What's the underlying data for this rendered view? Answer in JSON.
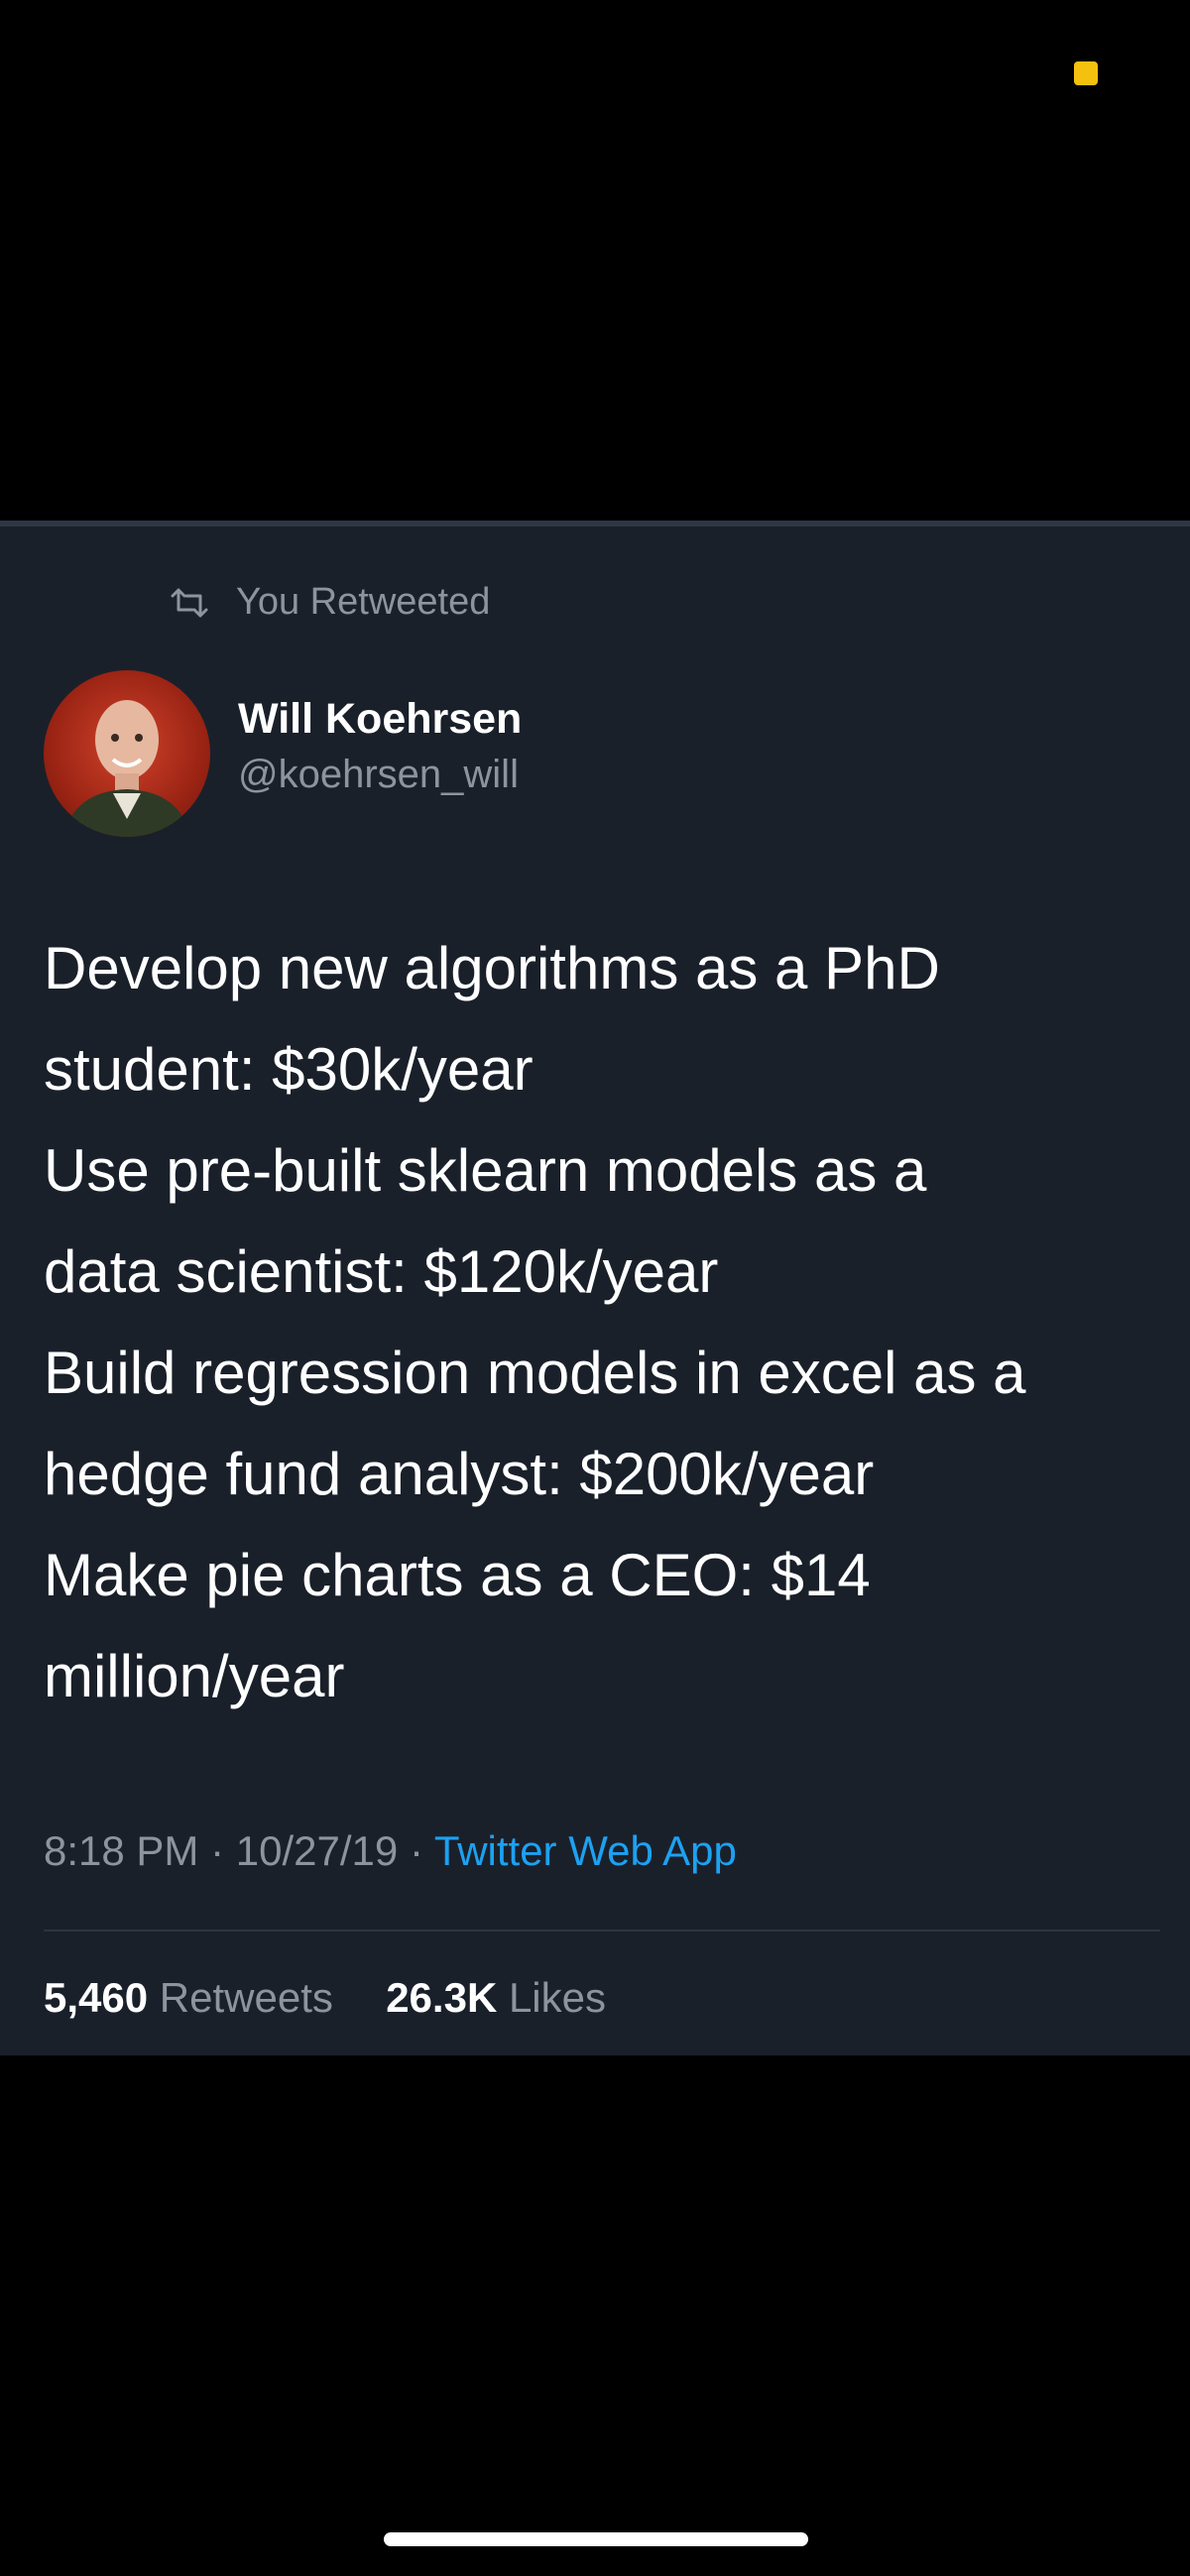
{
  "status_bar": {
    "indicator_color": "#f5c10f"
  },
  "tweet": {
    "retweet_label": "You Retweeted",
    "retweet_icon": "retweet-icon",
    "author": {
      "name": "Will Koehrsen",
      "handle": "@koehrsen_will",
      "avatar_icon": "avatar-photo"
    },
    "text_lines": [
      "Develop new algorithms as a PhD",
      "student: $30k/year",
      "Use pre-built sklearn models as a",
      "data scientist: $120k/year",
      "Build regression models in excel as a",
      "hedge fund analyst: $200k/year",
      "Make pie charts as a CEO: $14",
      "million/year"
    ],
    "time": "8:18 PM",
    "separator": "·",
    "date": "10/27/19",
    "source": "Twitter Web App",
    "stats": {
      "retweets_count": "5,460",
      "retweets_label": "Retweets",
      "likes_count": "26.3K",
      "likes_label": "Likes"
    }
  },
  "colors": {
    "card_background": "#1a202a",
    "link": "#1da1f2",
    "secondary_text": "#8c949d"
  }
}
